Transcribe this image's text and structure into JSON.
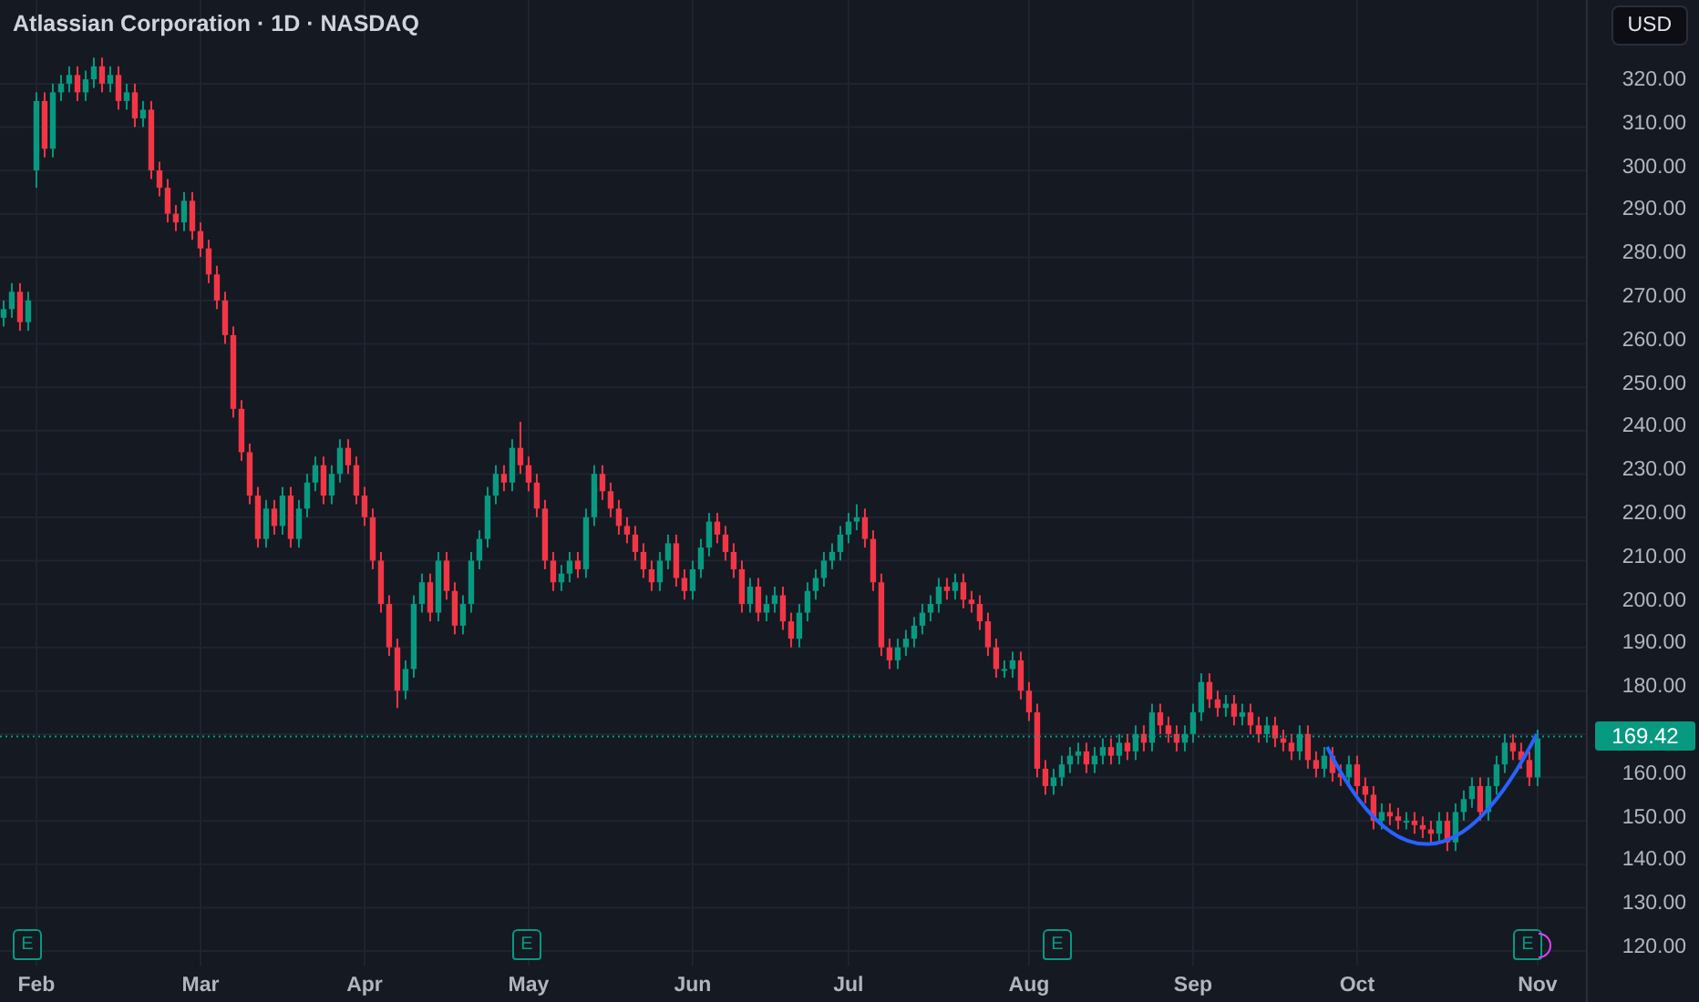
{
  "header": {
    "title": "Atlassian Corporation · 1D · NASDAQ"
  },
  "currency_button": "USD",
  "chart_data": {
    "type": "candlestick",
    "grid": true,
    "ylim": [
      116.6,
      339.3
    ],
    "ref_lines": [
      {
        "axis": "y",
        "value": 169.42
      }
    ],
    "categories": [
      null,
      null,
      null,
      null,
      "Feb",
      null,
      null,
      null,
      null,
      null,
      null,
      null,
      null,
      null,
      null,
      null,
      null,
      null,
      null,
      null,
      null,
      null,
      null,
      null,
      "Mar",
      null,
      null,
      null,
      null,
      null,
      null,
      null,
      null,
      null,
      null,
      null,
      null,
      null,
      null,
      null,
      null,
      null,
      null,
      null,
      "Apr",
      null,
      null,
      null,
      null,
      null,
      null,
      null,
      null,
      null,
      null,
      null,
      null,
      null,
      null,
      null,
      null,
      null,
      null,
      null,
      "May",
      null,
      null,
      null,
      null,
      null,
      null,
      null,
      null,
      null,
      null,
      null,
      null,
      null,
      null,
      null,
      null,
      null,
      null,
      null,
      "Jun",
      null,
      null,
      null,
      null,
      null,
      null,
      null,
      null,
      null,
      null,
      null,
      null,
      null,
      null,
      null,
      null,
      null,
      null,
      "Jul",
      null,
      null,
      null,
      null,
      null,
      null,
      null,
      null,
      null,
      null,
      null,
      null,
      null,
      null,
      null,
      null,
      null,
      null,
      null,
      null,
      null,
      "Aug",
      null,
      null,
      null,
      null,
      null,
      null,
      null,
      null,
      null,
      null,
      null,
      null,
      null,
      null,
      null,
      null,
      null,
      null,
      null,
      "Sep",
      null,
      null,
      null,
      null,
      null,
      null,
      null,
      null,
      null,
      null,
      null,
      null,
      null,
      null,
      null,
      null,
      null,
      null,
      null,
      "Oct",
      null,
      null,
      null,
      null,
      null,
      null,
      null,
      null,
      null,
      null,
      null,
      null,
      null,
      null,
      null,
      null,
      null,
      null,
      null,
      null,
      null,
      "Nov"
    ],
    "ohlc": [
      [
        266,
        270,
        264,
        268
      ],
      [
        268,
        274,
        266,
        272
      ],
      [
        272,
        274,
        263,
        265
      ],
      [
        265,
        272,
        263,
        270
      ],
      [
        300,
        318,
        296,
        316
      ],
      [
        316,
        318,
        303,
        305
      ],
      [
        305,
        320,
        303,
        318
      ],
      [
        318,
        322,
        316,
        320
      ],
      [
        320,
        324,
        318,
        322
      ],
      [
        322,
        324,
        316,
        318
      ],
      [
        318,
        323,
        316,
        321
      ],
      [
        321,
        326,
        319,
        324
      ],
      [
        324,
        326,
        318,
        320
      ],
      [
        320,
        324,
        318,
        322
      ],
      [
        322,
        324,
        314,
        316
      ],
      [
        316,
        320,
        314,
        318
      ],
      [
        318,
        320,
        310,
        312
      ],
      [
        312,
        316,
        310,
        314
      ],
      [
        314,
        316,
        298,
        300
      ],
      [
        300,
        302,
        294,
        296
      ],
      [
        296,
        298,
        288,
        290
      ],
      [
        290,
        292,
        286,
        288
      ],
      [
        288,
        295,
        286,
        293
      ],
      [
        293,
        295,
        284,
        286
      ],
      [
        286,
        288,
        280,
        282
      ],
      [
        282,
        284,
        274,
        276
      ],
      [
        276,
        278,
        268,
        270
      ],
      [
        270,
        272,
        260,
        262
      ],
      [
        262,
        264,
        243,
        245
      ],
      [
        245,
        247,
        233,
        235
      ],
      [
        235,
        237,
        223,
        225
      ],
      [
        225,
        227,
        213,
        215
      ],
      [
        215,
        224,
        213,
        222
      ],
      [
        222,
        224,
        216,
        218
      ],
      [
        218,
        227,
        216,
        225
      ],
      [
        225,
        227,
        213,
        215
      ],
      [
        215,
        224,
        213,
        222
      ],
      [
        222,
        230,
        220,
        228
      ],
      [
        228,
        234,
        226,
        232
      ],
      [
        232,
        234,
        223,
        225
      ],
      [
        225,
        232,
        223,
        230
      ],
      [
        230,
        238,
        228,
        236
      ],
      [
        236,
        238,
        230,
        232
      ],
      [
        232,
        234,
        223,
        225
      ],
      [
        225,
        227,
        218,
        220
      ],
      [
        220,
        222,
        208,
        210
      ],
      [
        210,
        212,
        198,
        200
      ],
      [
        200,
        202,
        188,
        190
      ],
      [
        190,
        192,
        176,
        180
      ],
      [
        180,
        187,
        178,
        185
      ],
      [
        185,
        202,
        183,
        200
      ],
      [
        200,
        207,
        198,
        205
      ],
      [
        205,
        207,
        196,
        198
      ],
      [
        198,
        212,
        196,
        210
      ],
      [
        210,
        212,
        201,
        203
      ],
      [
        203,
        205,
        193,
        195
      ],
      [
        195,
        202,
        193,
        200
      ],
      [
        200,
        212,
        198,
        210
      ],
      [
        210,
        217,
        208,
        215
      ],
      [
        215,
        227,
        213,
        225
      ],
      [
        225,
        232,
        223,
        230
      ],
      [
        230,
        232,
        226,
        228
      ],
      [
        228,
        238,
        226,
        236
      ],
      [
        236,
        242,
        230,
        232
      ],
      [
        232,
        234,
        226,
        228
      ],
      [
        228,
        230,
        220,
        222
      ],
      [
        222,
        224,
        208,
        210
      ],
      [
        210,
        212,
        203,
        205
      ],
      [
        205,
        209,
        203,
        207
      ],
      [
        207,
        212,
        205,
        210
      ],
      [
        210,
        212,
        206,
        208
      ],
      [
        208,
        222,
        206,
        220
      ],
      [
        220,
        232,
        218,
        230
      ],
      [
        230,
        232,
        224,
        226
      ],
      [
        226,
        228,
        220,
        222
      ],
      [
        222,
        224,
        216,
        218
      ],
      [
        218,
        220,
        214,
        216
      ],
      [
        216,
        218,
        210,
        212
      ],
      [
        212,
        214,
        206,
        208
      ],
      [
        208,
        210,
        203,
        205
      ],
      [
        205,
        212,
        203,
        210
      ],
      [
        210,
        216,
        208,
        214
      ],
      [
        214,
        216,
        204,
        206
      ],
      [
        206,
        208,
        201,
        203
      ],
      [
        203,
        210,
        201,
        208
      ],
      [
        208,
        215,
        206,
        213
      ],
      [
        213,
        221,
        211,
        219
      ],
      [
        219,
        221,
        214,
        216
      ],
      [
        216,
        218,
        210,
        212
      ],
      [
        212,
        214,
        206,
        208
      ],
      [
        208,
        210,
        198,
        200
      ],
      [
        200,
        206,
        198,
        204
      ],
      [
        204,
        206,
        196,
        198
      ],
      [
        198,
        202,
        196,
        200
      ],
      [
        200,
        204,
        198,
        202
      ],
      [
        202,
        204,
        194,
        196
      ],
      [
        196,
        198,
        190,
        192
      ],
      [
        192,
        200,
        190,
        198
      ],
      [
        198,
        205,
        196,
        203
      ],
      [
        203,
        208,
        201,
        206
      ],
      [
        206,
        212,
        204,
        210
      ],
      [
        210,
        214,
        208,
        212
      ],
      [
        212,
        218,
        210,
        216
      ],
      [
        216,
        221,
        214,
        219
      ],
      [
        219,
        223,
        217,
        220
      ],
      [
        220,
        222,
        213,
        215
      ],
      [
        215,
        217,
        203,
        205
      ],
      [
        205,
        207,
        188,
        190
      ],
      [
        190,
        192,
        185,
        187
      ],
      [
        187,
        192,
        185,
        190
      ],
      [
        190,
        194,
        188,
        192
      ],
      [
        192,
        197,
        190,
        195
      ],
      [
        195,
        200,
        193,
        198
      ],
      [
        198,
        202,
        196,
        200
      ],
      [
        200,
        206,
        198,
        204
      ],
      [
        204,
        206,
        201,
        203
      ],
      [
        203,
        207,
        201,
        205
      ],
      [
        205,
        207,
        199,
        201
      ],
      [
        201,
        203,
        198,
        200
      ],
      [
        200,
        202,
        194,
        196
      ],
      [
        196,
        198,
        188,
        190
      ],
      [
        190,
        192,
        183,
        185
      ],
      [
        185,
        187,
        183,
        185
      ],
      [
        185,
        189,
        183,
        187
      ],
      [
        187,
        189,
        178,
        180
      ],
      [
        180,
        182,
        173,
        175
      ],
      [
        175,
        177,
        160,
        162
      ],
      [
        162,
        164,
        156,
        158
      ],
      [
        158,
        162,
        156,
        160
      ],
      [
        160,
        165,
        158,
        163
      ],
      [
        163,
        167,
        161,
        165
      ],
      [
        165,
        168,
        163,
        166
      ],
      [
        166,
        168,
        161,
        163
      ],
      [
        163,
        167,
        161,
        165
      ],
      [
        165,
        169,
        163,
        167
      ],
      [
        167,
        169,
        163,
        165
      ],
      [
        165,
        170,
        163,
        168
      ],
      [
        168,
        170,
        164,
        166
      ],
      [
        166,
        172,
        164,
        170
      ],
      [
        170,
        172,
        166,
        168
      ],
      [
        168,
        177,
        166,
        175
      ],
      [
        175,
        177,
        170,
        172
      ],
      [
        172,
        174,
        168,
        170
      ],
      [
        170,
        172,
        166,
        168
      ],
      [
        168,
        172,
        166,
        170
      ],
      [
        170,
        177,
        168,
        175
      ],
      [
        175,
        184,
        173,
        182
      ],
      [
        182,
        184,
        176,
        178
      ],
      [
        178,
        180,
        174,
        176
      ],
      [
        176,
        179,
        174,
        177
      ],
      [
        177,
        179,
        172,
        174
      ],
      [
        174,
        177,
        172,
        175
      ],
      [
        175,
        177,
        170,
        172
      ],
      [
        172,
        174,
        168,
        170
      ],
      [
        170,
        174,
        168,
        172
      ],
      [
        172,
        174,
        167,
        169
      ],
      [
        169,
        171,
        166,
        168
      ],
      [
        168,
        170,
        164,
        166
      ],
      [
        166,
        172,
        164,
        170
      ],
      [
        170,
        172,
        162,
        164
      ],
      [
        164,
        166,
        160,
        162
      ],
      [
        162,
        167,
        160,
        165
      ],
      [
        165,
        167,
        159,
        161
      ],
      [
        161,
        163,
        158,
        160
      ],
      [
        160,
        165,
        158,
        163
      ],
      [
        163,
        165,
        156,
        158
      ],
      [
        158,
        160,
        154,
        156
      ],
      [
        156,
        158,
        148,
        150
      ],
      [
        150,
        154,
        148,
        152
      ],
      [
        152,
        154,
        149,
        151
      ],
      [
        151,
        153,
        148,
        150
      ],
      [
        150,
        152,
        148,
        150
      ],
      [
        150,
        152,
        147,
        149
      ],
      [
        149,
        151,
        146,
        148
      ],
      [
        148,
        150,
        145,
        147
      ],
      [
        147,
        152,
        145,
        150
      ],
      [
        150,
        152,
        143,
        145
      ],
      [
        145,
        154,
        143,
        152
      ],
      [
        152,
        157,
        150,
        155
      ],
      [
        155,
        160,
        153,
        158
      ],
      [
        158,
        160,
        150,
        152
      ],
      [
        152,
        160,
        150,
        158
      ],
      [
        158,
        165,
        156,
        163
      ],
      [
        163,
        170,
        161,
        168
      ],
      [
        168,
        170,
        164,
        166
      ],
      [
        166,
        168,
        162,
        164
      ],
      [
        164,
        166,
        158,
        160
      ],
      [
        160,
        171,
        158,
        169
      ]
    ],
    "yticks": [
      {
        "value": 320,
        "label": "320.00"
      },
      {
        "value": 310,
        "label": "310.00"
      },
      {
        "value": 300,
        "label": "300.00"
      },
      {
        "value": 290,
        "label": "290.00"
      },
      {
        "value": 280,
        "label": "280.00"
      },
      {
        "value": 270,
        "label": "270.00"
      },
      {
        "value": 260,
        "label": "260.00"
      },
      {
        "value": 250,
        "label": "250.00"
      },
      {
        "value": 240,
        "label": "240.00"
      },
      {
        "value": 230,
        "label": "230.00"
      },
      {
        "value": 220,
        "label": "220.00"
      },
      {
        "value": 210,
        "label": "210.00"
      },
      {
        "value": 200,
        "label": "200.00"
      },
      {
        "value": 190,
        "label": "190.00"
      },
      {
        "value": 180,
        "label": "180.00"
      },
      {
        "value": 160,
        "label": "160.00"
      },
      {
        "value": 150,
        "label": "150.00"
      },
      {
        "value": 140,
        "label": "140.00"
      },
      {
        "value": 130,
        "label": "130.00"
      },
      {
        "value": 120,
        "label": "120.00"
      }
    ]
  },
  "current_price": "169.42",
  "earnings_markers": [
    {
      "label": "E",
      "upcoming": false
    },
    {
      "label": "E",
      "upcoming": false
    },
    {
      "label": "E",
      "upcoming": false
    },
    {
      "label": "E",
      "upcoming": true
    }
  ]
}
